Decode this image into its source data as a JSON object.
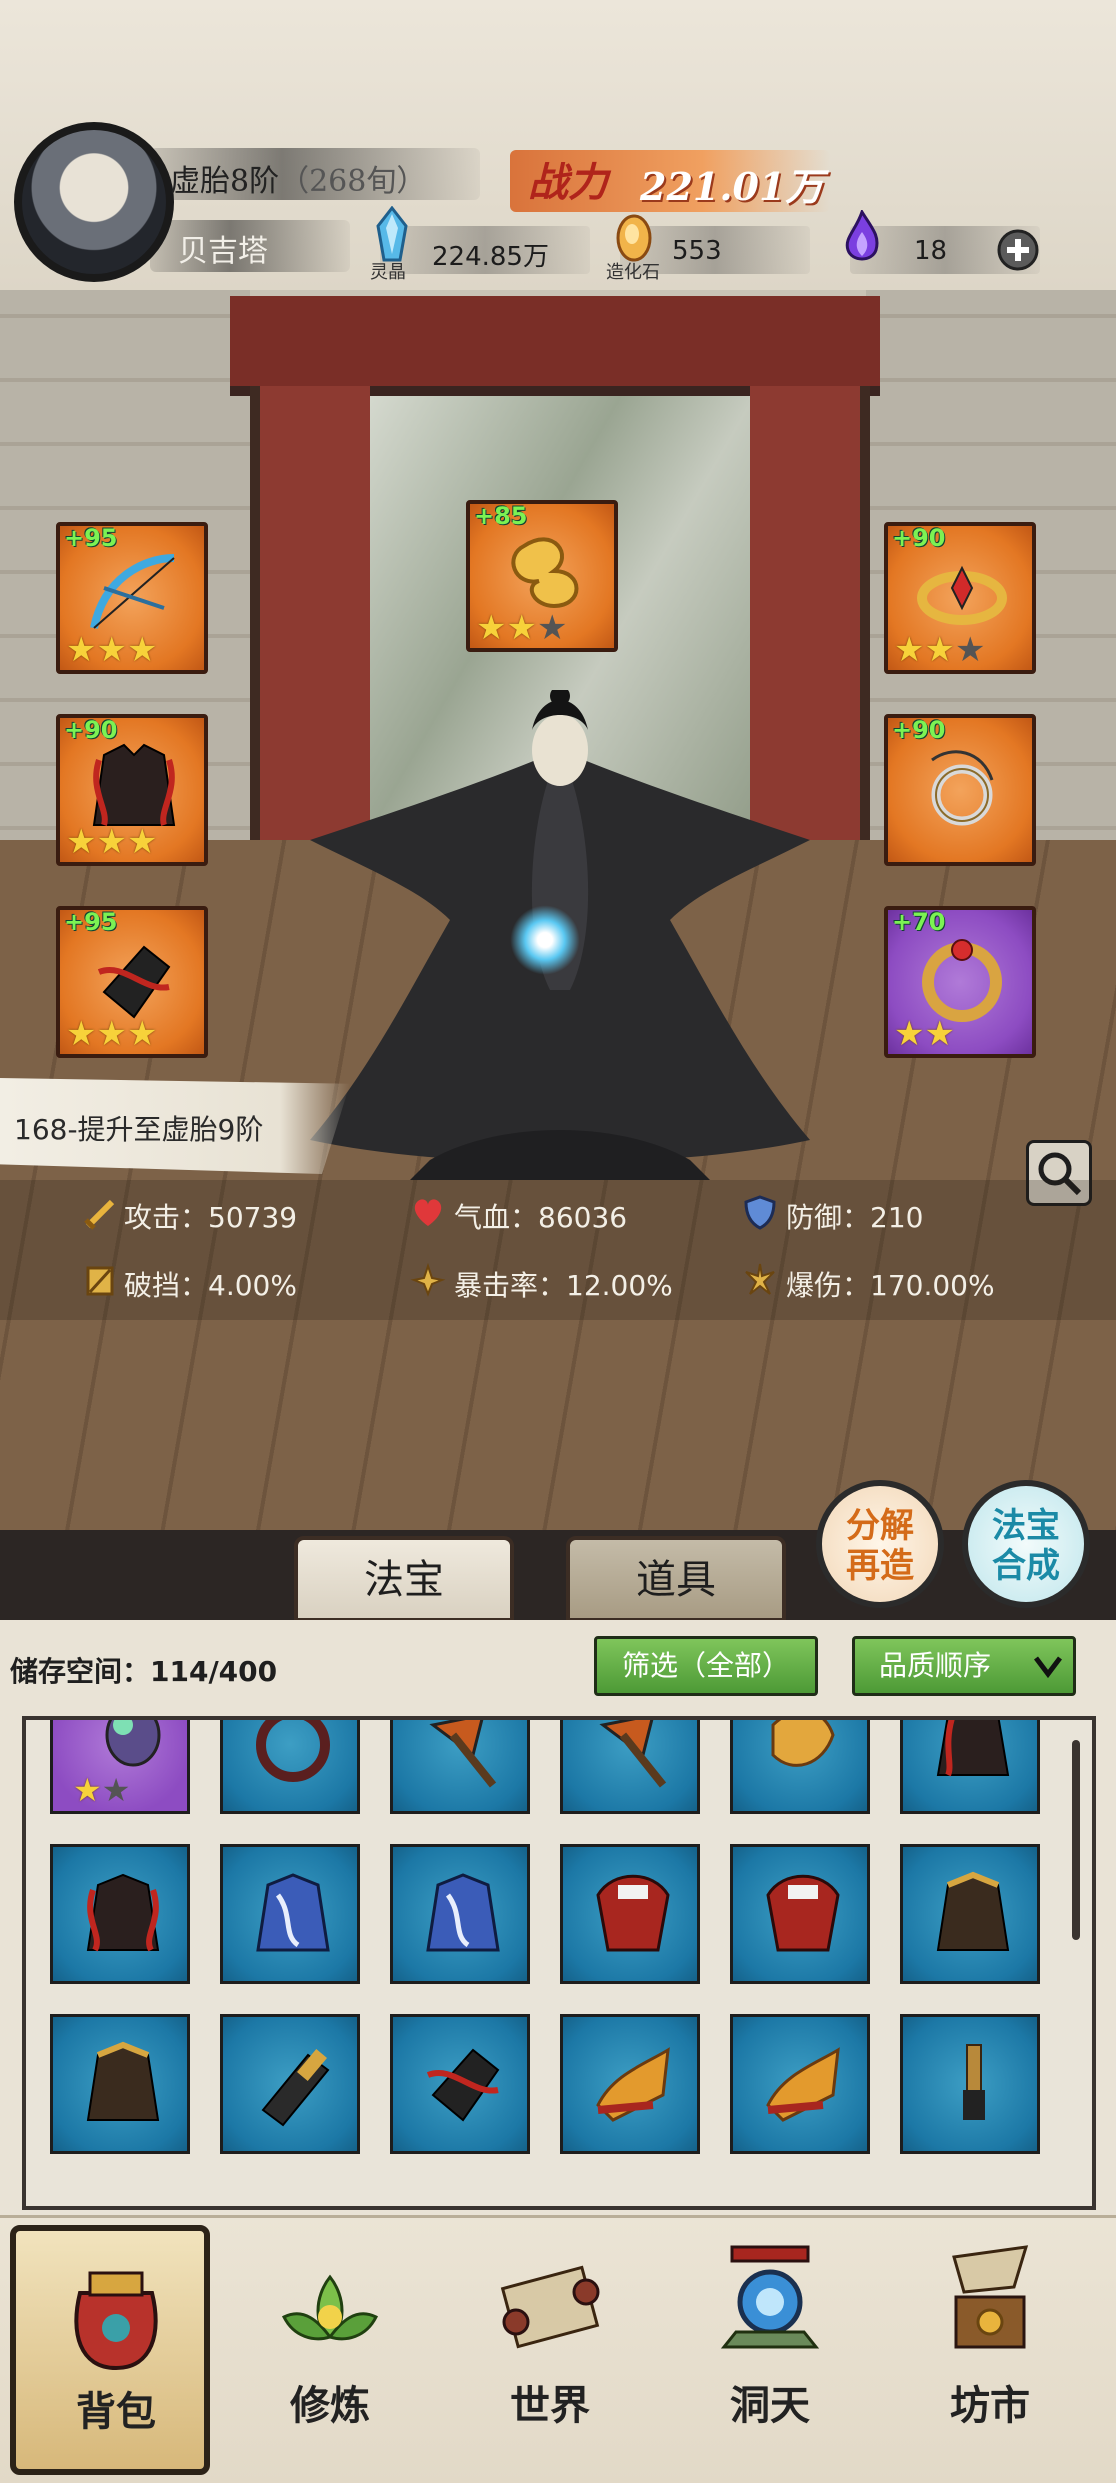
{
  "header": {
    "realm": "虚胎8阶",
    "realm_sub": "（268旬）",
    "username": "贝吉塔",
    "power_label": "战力",
    "power_value": "221.01万",
    "resources": [
      {
        "icon": "spirit-crystal-icon",
        "label": "灵晶",
        "value": "224.85万"
      },
      {
        "icon": "creation-stone-icon",
        "label": "造化石",
        "value": "553"
      },
      {
        "icon": "purple-flame-icon",
        "label": "",
        "value": "18"
      }
    ],
    "add_icon": "plus-icon"
  },
  "equipment": {
    "left": [
      {
        "name": "bow",
        "level": "+95",
        "stars": 3,
        "max_stars": 3,
        "quality": "orange"
      },
      {
        "name": "armor",
        "level": "+90",
        "stars": 3,
        "max_stars": 3,
        "quality": "orange"
      },
      {
        "name": "gauntlet",
        "level": "+95",
        "stars": 3,
        "max_stars": 3,
        "quality": "orange"
      }
    ],
    "top": {
      "name": "cloud-charm",
      "level": "+85",
      "stars": 2,
      "max_stars": 3,
      "quality": "orange"
    },
    "right": [
      {
        "name": "crown",
        "level": "+90",
        "stars": 2,
        "max_stars": 3,
        "quality": "orange"
      },
      {
        "name": "pendant",
        "level": "+90",
        "stars": 0,
        "max_stars": 0,
        "quality": "orange"
      },
      {
        "name": "ring",
        "level": "+70",
        "stars": 2,
        "max_stars": 2,
        "quality": "purple"
      }
    ]
  },
  "level_banner": "168-提升至虚胎9阶",
  "stats": [
    {
      "icon": "sword-icon",
      "label": "攻击：50739"
    },
    {
      "icon": "heart-icon",
      "label": "气血：86036"
    },
    {
      "icon": "shield-icon",
      "label": "防御：210"
    },
    {
      "icon": "armor-break-icon",
      "label": "破挡：4.00%"
    },
    {
      "icon": "crit-rate-icon",
      "label": "暴击率：12.00%"
    },
    {
      "icon": "crit-damage-icon",
      "label": "爆伤：170.00%"
    }
  ],
  "tabs": {
    "fabao": "法宝",
    "daoju": "道具"
  },
  "buttons": {
    "decompose_l1": "分解",
    "decompose_l2": "再造",
    "combine_l1": "法宝",
    "combine_l2": "合成"
  },
  "inventory": {
    "storage": "储存空间：114/400",
    "filter": "筛选（全部）",
    "sort": "品质顺序",
    "sort_icon": "chevron-down-icon",
    "rows": [
      [
        "staff-item",
        "spiked-wheel-item",
        "axe-item",
        "axe-item",
        "golden-beast-item",
        "red-robe-item"
      ],
      [
        "red-armor-item",
        "blue-robe-item",
        "blue-robe-item",
        "demon-mask-item",
        "demon-mask-item",
        "dark-robe-item"
      ],
      [
        "dark-robe-item",
        "bracer-item",
        "red-gauntlet-item",
        "phoenix-boot-item",
        "phoenix-boot-item",
        "dagger-item"
      ]
    ]
  },
  "nav": [
    {
      "label": "背包",
      "icon": "bag-icon"
    },
    {
      "label": "修炼",
      "icon": "lotus-icon"
    },
    {
      "label": "世界",
      "icon": "scroll-icon"
    },
    {
      "label": "洞天",
      "icon": "portal-icon"
    },
    {
      "label": "坊市",
      "icon": "market-icon"
    }
  ]
}
